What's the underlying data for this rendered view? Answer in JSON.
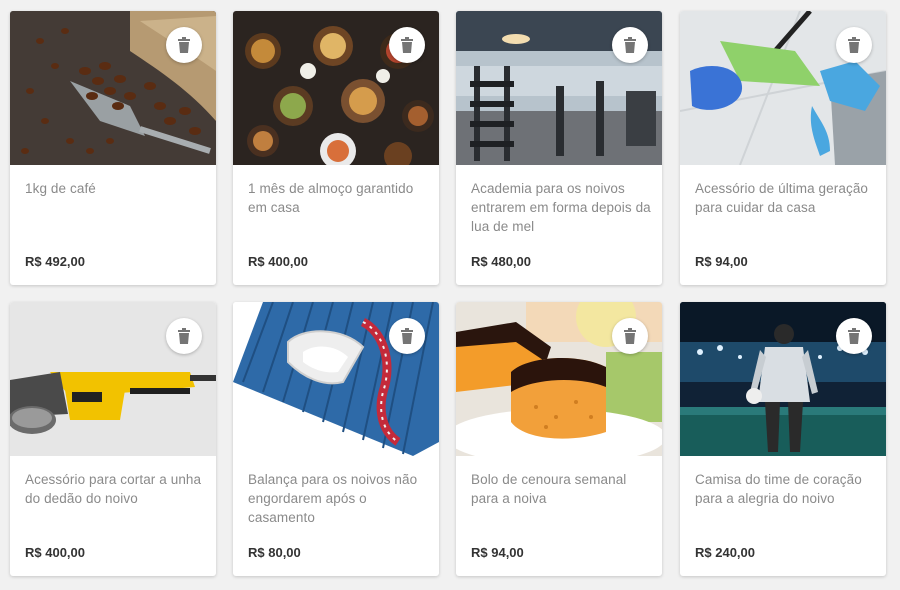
{
  "products": [
    {
      "title": "1kg de café",
      "price": "R$ 492,00",
      "image": "coffee-beans-image",
      "delete_icon": "trash-icon"
    },
    {
      "title": "1 mês de almoço garantido em casa",
      "price": "R$ 400,00",
      "image": "food-table-image",
      "delete_icon": "trash-icon"
    },
    {
      "title": "Academia para os noivos entrarem em forma depois da lua de mel",
      "price": "R$ 480,00",
      "image": "gym-image",
      "delete_icon": "trash-icon"
    },
    {
      "title": "Acessório de última geração para cuidar da casa",
      "price": "R$ 94,00",
      "image": "cleaning-mop-image",
      "delete_icon": "trash-icon"
    },
    {
      "title": "Acessório para cortar a unha do dedão do noivo",
      "price": "R$ 400,00",
      "image": "angle-grinder-image",
      "delete_icon": "trash-icon"
    },
    {
      "title": "Balança para os noivos não engordarem após o casamento",
      "price": "R$ 80,00",
      "image": "bathroom-scale-image",
      "delete_icon": "trash-icon"
    },
    {
      "title": "Bolo de cenoura semanal para a noiva",
      "price": "R$ 94,00",
      "image": "carrot-cake-image",
      "delete_icon": "trash-icon"
    },
    {
      "title": "Camisa do time de coração para a alegria do noivo",
      "price": "R$ 240,00",
      "image": "soccer-stadium-image",
      "delete_icon": "trash-icon"
    }
  ]
}
